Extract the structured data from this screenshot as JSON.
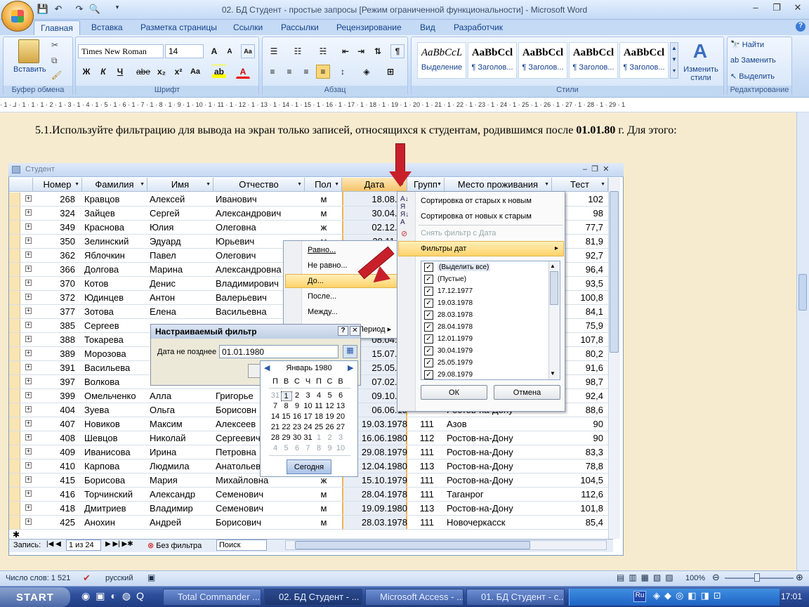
{
  "window": {
    "title": "02. БД Студент - простые запросы [Режим ограниченной функциональности] - Microsoft Word",
    "controls": [
      "–",
      "❐",
      "✕"
    ]
  },
  "ribbon": {
    "tabs": [
      "Главная",
      "Вставка",
      "Разметка страницы",
      "Ссылки",
      "Рассылки",
      "Рецензирование",
      "Вид",
      "Разработчик"
    ],
    "clipboard": {
      "paste": "Вставить",
      "label": "Буфер обмена"
    },
    "font": {
      "name": "Times New Roman",
      "size": "14",
      "label": "Шрифт",
      "bold": "Ж",
      "italic": "К",
      "underline": "Ч",
      "strike": "abe"
    },
    "paragraph": {
      "label": "Абзац"
    },
    "styles": {
      "label": "Стили",
      "tiles": [
        {
          "sample": "AaBbCcL",
          "name": "Выделение"
        },
        {
          "sample": "AaBbCcl",
          "name": "¶ Заголов..."
        },
        {
          "sample": "AaBbCcl",
          "name": "¶ Заголов..."
        },
        {
          "sample": "AaBbCcl",
          "name": "¶ Заголов..."
        },
        {
          "sample": "AaBbCcl",
          "name": "¶ Заголов..."
        }
      ],
      "change": "Изменить стили"
    },
    "editing": {
      "label": "Редактирование",
      "find": "Найти",
      "replace": "Заменить",
      "select": "Выделить"
    }
  },
  "ruler": "· 1 · ⅃ · 1 · 1 · 1 · 2 · 1 · 3 · 1 · 4 · 1 · 5 · 1 · 6 · 1 · 7 · 1 · 8 · 1 · 9 · 1 · 10 · 1 · 11 · 1 · 12 · 1 · 13 · 1 · 14 · 1 · 15 · 1 · 16 · 1 · 17 · 1 · 18 · 1 · 19 · 1 · 20 · 1 · 21 · 1 · 22 · 1 · 23 · 1 · 24 · 1 · 25 · 1 · 26 · 1 · 27 · 1 · 28 · 1 · 29 · 1",
  "document": {
    "text_a": "5.1.Используйте фильтрацию для вывода на экран только записей, относящихся к студентам, родившимся после ",
    "text_bold": "01.01.80",
    "text_b": " г. Для этого:"
  },
  "access": {
    "title": "Студент",
    "columns": [
      "Номер",
      "Фамилия",
      "Имя",
      "Отчество",
      "Пол",
      "Дата",
      "Групп",
      "Место проживания",
      "Тест"
    ],
    "rows": [
      [
        "268",
        "Кравцов",
        "Алексей",
        "Иванович",
        "м",
        "18.08.19",
        "",
        "",
        "102"
      ],
      [
        "324",
        "Зайцев",
        "Сергей",
        "Александрович",
        "м",
        "30.04.19",
        "",
        "",
        "98"
      ],
      [
        "349",
        "Краснова",
        "Юлия",
        "Олеговна",
        "ж",
        "02.12.19",
        "",
        "",
        "77,7"
      ],
      [
        "350",
        "Зелинский",
        "Эдуард",
        "Юрьевич",
        "м",
        "29.11.19",
        "",
        "",
        "81,9"
      ],
      [
        "362",
        "Яблочкин",
        "Павел",
        "Олегович",
        "",
        "",
        "",
        "",
        "92,7"
      ],
      [
        "366",
        "Долгова",
        "Марина",
        "Александровна",
        "",
        "",
        "",
        "",
        "96,4"
      ],
      [
        "370",
        "Котов",
        "Денис",
        "Владимирович",
        "",
        "",
        "",
        "",
        "93,5"
      ],
      [
        "372",
        "Юдинцев",
        "Антон",
        "Валерьевич",
        "",
        "",
        "",
        "",
        "100,8"
      ],
      [
        "377",
        "Зотова",
        "Елена",
        "Васильевна",
        "",
        "",
        "",
        "",
        "84,1"
      ],
      [
        "385",
        "Сергеев",
        "",
        "",
        "",
        "",
        "",
        "",
        "75,9"
      ],
      [
        "388",
        "Токарева",
        "",
        "",
        "",
        "08.04.19",
        "",
        "",
        "107,8"
      ],
      [
        "389",
        "Морозова",
        "",
        "",
        "",
        "15.07.19",
        "",
        "",
        "80,2"
      ],
      [
        "391",
        "Васильева",
        "",
        "",
        "",
        "25.05.19",
        "",
        "",
        "91,6"
      ],
      [
        "397",
        "Волкова",
        "",
        "",
        "",
        "07.02.19",
        "",
        "",
        "98,7"
      ],
      [
        "399",
        "Омельченко",
        "Алла",
        "Григорье",
        "",
        "09.10.19",
        "",
        "",
        "92,4"
      ],
      [
        "404",
        "Зуева",
        "Ольга",
        "Борисовн",
        "",
        "06.06.19",
        "",
        "Ростов-на-Дону",
        "88,6"
      ],
      [
        "407",
        "Новиков",
        "Максим",
        "Алексеев",
        "",
        "19.03.1978",
        "111",
        "Азов",
        "90"
      ],
      [
        "408",
        "Шевцов",
        "Николай",
        "Сергеевич",
        "",
        "16.06.1980",
        "112",
        "Ростов-на-Дону",
        "90"
      ],
      [
        "409",
        "Иванисова",
        "Ирина",
        "Петровна",
        "",
        "29.08.1979",
        "111",
        "Ростов-на-Дону",
        "83,3"
      ],
      [
        "410",
        "Карпова",
        "Людмила",
        "Анатольев",
        "",
        "12.04.1980",
        "113",
        "Ростов-на-Дону",
        "78,8"
      ],
      [
        "415",
        "Борисова",
        "Мария",
        "Михайловна",
        "ж",
        "15.10.1979",
        "111",
        "Ростов-на-Дону",
        "104,5"
      ],
      [
        "416",
        "Торчинский",
        "Александр",
        "Семенович",
        "м",
        "28.04.1978",
        "111",
        "Таганрог",
        "112,6"
      ],
      [
        "418",
        "Дмитриев",
        "Владимир",
        "Семенович",
        "м",
        "19.09.1980",
        "113",
        "Ростов-на-Дону",
        "101,8"
      ],
      [
        "425",
        "Анохин",
        "Андрей",
        "Борисович",
        "м",
        "28.03.1978",
        "111",
        "Новочеркасск",
        "85,4"
      ]
    ],
    "nav": {
      "label": "Запись:",
      "position": "1 из 24",
      "filter": "Без фильтра",
      "search": "Поиск"
    }
  },
  "context_menu": {
    "sort_asc": "Сортировка от старых к новым",
    "sort_desc": "Сортировка от новых к старым",
    "clear": "Снять фильтр с Дата",
    "date_filters": "Фильтры дат",
    "checks": [
      "(Выделить все)",
      "(Пустые)",
      "17.12.1977",
      "19.03.1978",
      "28.03.1978",
      "28.04.1978",
      "12.01.1979",
      "30.04.1979",
      "25.05.1979",
      "29.08.1979"
    ],
    "ok": "ОК",
    "cancel": "Отмена"
  },
  "submenu": {
    "equal": "Равно...",
    "not_equal": "Не равно...",
    "before": "До...",
    "after": "После...",
    "between": "Между...",
    "period": "Период"
  },
  "dialog": {
    "title": "Настраиваемый фильтр",
    "help": "?",
    "close": "✕",
    "label": "Дата не позднее",
    "value": "01.01.1980"
  },
  "calendar": {
    "month": "Январь 1980",
    "weekdays": [
      "П",
      "В",
      "С",
      "Ч",
      "П",
      "С",
      "В"
    ],
    "weeks": [
      [
        "31",
        "1",
        "2",
        "3",
        "4",
        "5",
        "6"
      ],
      [
        "7",
        "8",
        "9",
        "10",
        "11",
        "12",
        "13"
      ],
      [
        "14",
        "15",
        "16",
        "17",
        "18",
        "19",
        "20"
      ],
      [
        "21",
        "22",
        "23",
        "24",
        "25",
        "26",
        "27"
      ],
      [
        "28",
        "29",
        "30",
        "31",
        "1",
        "2",
        "3"
      ],
      [
        "4",
        "5",
        "6",
        "7",
        "8",
        "9",
        "10"
      ]
    ],
    "today": "Сегодня"
  },
  "status": {
    "words": "Число слов: 1 521",
    "lang": "русский",
    "zoom": "100%"
  },
  "taskbar": {
    "start": "START",
    "items": [
      "Total Commander ...",
      "02. БД Студент - ...",
      "Microsoft Access - ...",
      "01. БД Студент - с..."
    ],
    "clock": "17:01",
    "lang": "Ru"
  }
}
